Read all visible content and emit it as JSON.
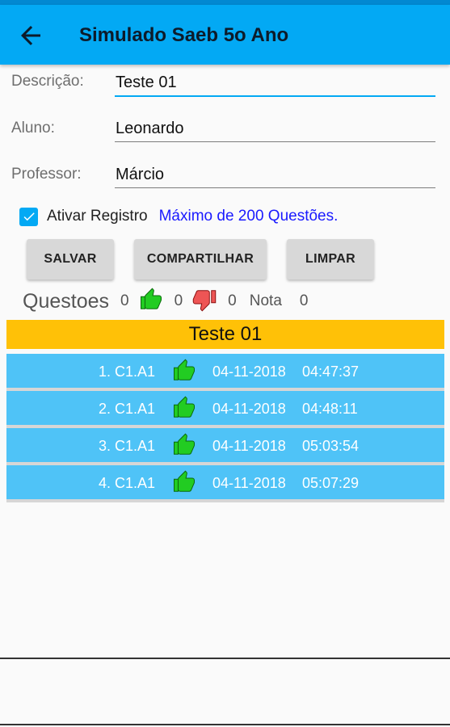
{
  "appbar": {
    "title": "Simulado Saeb 5o Ano",
    "color": "#03a9f4"
  },
  "form": {
    "descricao": {
      "label": "Descrição:",
      "value": "Teste 01"
    },
    "aluno": {
      "label": "Aluno:",
      "value": "Leonardo"
    },
    "professor": {
      "label": "Professor:",
      "value": "Márcio"
    }
  },
  "register": {
    "checkbox_label": "Ativar Registro",
    "checked": true,
    "max_text": "Máximo de 200 Questões."
  },
  "buttons": {
    "save": "SALVAR",
    "share": "COMPARTILHAR",
    "clear": "LIMPAR"
  },
  "stats": {
    "title": "Questoes",
    "total": "0",
    "correct": "0",
    "wrong": "0",
    "grade_label": "Nota",
    "grade": "0"
  },
  "test": {
    "title": "Teste 01",
    "header_color": "#ffc107",
    "rows": [
      {
        "label": "1. C1.A1",
        "icon": "thumbs-up-icon",
        "date": "04-11-2018",
        "time": "04:47:37"
      },
      {
        "label": "2. C1.A1",
        "icon": "thumbs-up-icon",
        "date": "04-11-2018",
        "time": "04:48:11"
      },
      {
        "label": "3. C1.A1",
        "icon": "thumbs-up-icon",
        "date": "04-11-2018",
        "time": "05:03:54"
      },
      {
        "label": "4. C1.A1",
        "icon": "thumbs-up-icon",
        "date": "04-11-2018",
        "time": "05:07:29"
      }
    ]
  }
}
